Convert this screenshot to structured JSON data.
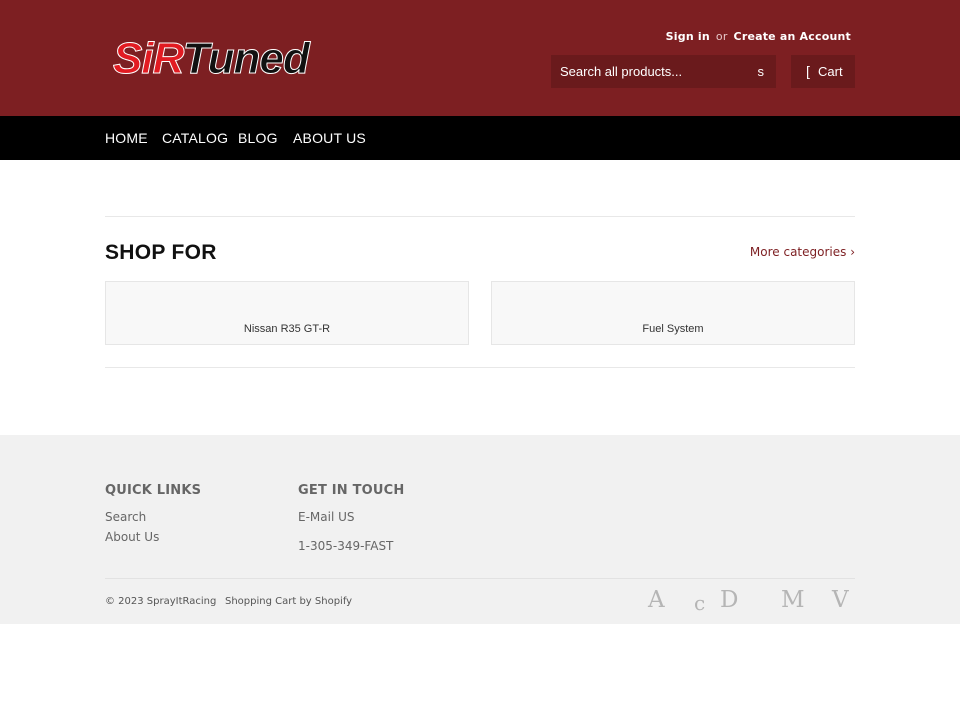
{
  "header": {
    "logo": {
      "part1": "SiR",
      "part2": "Tuned"
    },
    "account": {
      "sign_in": "Sign in",
      "or": "or",
      "create": "Create an Account"
    },
    "search": {
      "placeholder": "Search all products...",
      "button_icon": "s"
    },
    "cart": {
      "icon": "[",
      "label": "Cart"
    }
  },
  "nav": {
    "items": [
      "HOME",
      "CATALOG",
      "BLOG",
      "ABOUT US"
    ]
  },
  "main": {
    "title": "SHOP FOR",
    "more": "More categories ›",
    "cards": [
      {
        "label": "Nissan R35 GT-R"
      },
      {
        "label": "Fuel System"
      }
    ]
  },
  "footer": {
    "quick_links": {
      "title": "QUICK LINKS",
      "links": [
        "Search",
        "About Us"
      ]
    },
    "get_in_touch": {
      "title": "GET IN TOUCH",
      "email": "E-Mail US",
      "phone": "1-305-349-FAST"
    },
    "copyright": "© 2023 SprayItRacing",
    "powered": "Shopping Cart by Shopify",
    "payment_icons": [
      "A",
      "c",
      "D",
      "M",
      "V"
    ]
  },
  "colors": {
    "brand": "#7d1f22",
    "nav": "#000000",
    "footer": "#f1f1f1"
  }
}
